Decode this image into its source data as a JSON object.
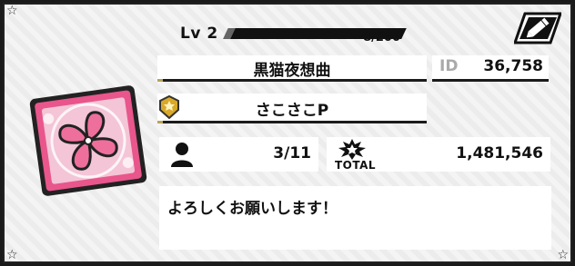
{
  "profile": {
    "level": "Lv 2",
    "exp": {
      "text": "8/200",
      "current": 8,
      "max": 200
    },
    "circle_name": "黒猫夜想曲",
    "id_label": "ID",
    "id_value": "36,758",
    "player_name": "さこさこP",
    "members": "3/11",
    "total_label": "TOTAL",
    "total_value": "1,481,546",
    "comment": "よろしくお願いします！"
  },
  "icons": {
    "edit": "pencil-icon",
    "emblem": "clover-emblem-icon",
    "rank": "rank-badge-icon",
    "members": "person-icon",
    "total": "total-burst-icon",
    "corner": "star-icon"
  },
  "colors": {
    "emblem_pink": "#e8568b",
    "emblem_light": "#f7b8cf",
    "rank_gold": "#d9a928",
    "underline_gold": "#b8a35a",
    "exp_bar": "#111111"
  }
}
